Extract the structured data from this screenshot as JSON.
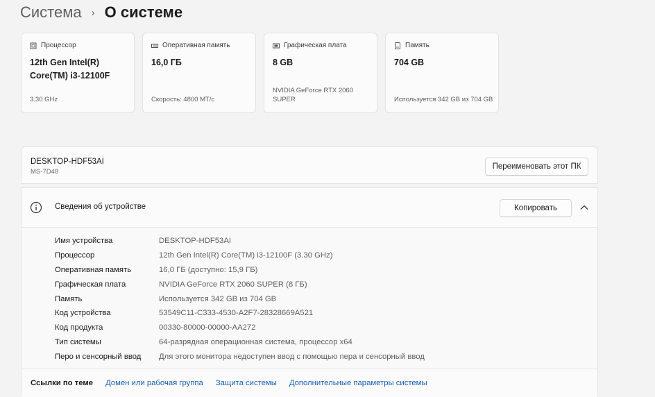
{
  "breadcrumb": {
    "parent": "Система",
    "separator": "›",
    "current": "О системе"
  },
  "cards": [
    {
      "icon": "cpu-icon",
      "label": "Процессор",
      "value": "12th Gen Intel(R) Core(TM) i3-12100F",
      "sub": "3.30 GHz"
    },
    {
      "icon": "memory-icon",
      "label": "Оперативная память",
      "value": "16,0 ГБ",
      "sub": "Скорость: 4800 МТ/с"
    },
    {
      "icon": "gpu-icon",
      "label": "Графическая плата",
      "value": "8 GB",
      "sub": "NVIDIA GeForce RTX 2060 SUPER"
    },
    {
      "icon": "storage-icon",
      "label": "Память",
      "value": "704 GB",
      "sub": "Используется 342 GB из 704 GB"
    }
  ],
  "pc": {
    "name": "DESKTOP-HDF53AI",
    "model": "MS-7D48",
    "rename_label": "Переименовать этот ПК"
  },
  "device_info": {
    "title": "Сведения об устройстве",
    "copy_label": "Копировать",
    "specs": [
      {
        "label": "Имя устройства",
        "value": "DESKTOP-HDF53AI"
      },
      {
        "label": "Процессор",
        "value": "12th Gen Intel(R) Core(TM) i3-12100F (3.30 GHz)"
      },
      {
        "label": "Оперативная память",
        "value": "16,0 ГБ (доступно: 15,9 ГБ)"
      },
      {
        "label": "Графическая плата",
        "value": "NVIDIA GeForce RTX 2060 SUPER (8 ГБ)"
      },
      {
        "label": "Память",
        "value": "Используется 342 GB из 704 GB"
      },
      {
        "label": "Код устройства",
        "value": "53549C11-C333-4530-A2F7-28328669A521"
      },
      {
        "label": "Код продукта",
        "value": "00330-80000-00000-AA272"
      },
      {
        "label": "Тип системы",
        "value": "64-разрядная операционная система, процессор x64"
      },
      {
        "label": "Перо и сенсорный ввод",
        "value": "Для этого монитора недоступен ввод с помощью пера и сенсорный ввод"
      }
    ]
  },
  "related_links": {
    "title": "Ссылки по теме",
    "links": [
      "Домен или рабочая группа",
      "Защита системы",
      "Дополнительные параметры системы"
    ]
  },
  "colors": {
    "background": "#f3f3f3",
    "card": "#fbfbfb",
    "link": "#1a5fb4"
  }
}
